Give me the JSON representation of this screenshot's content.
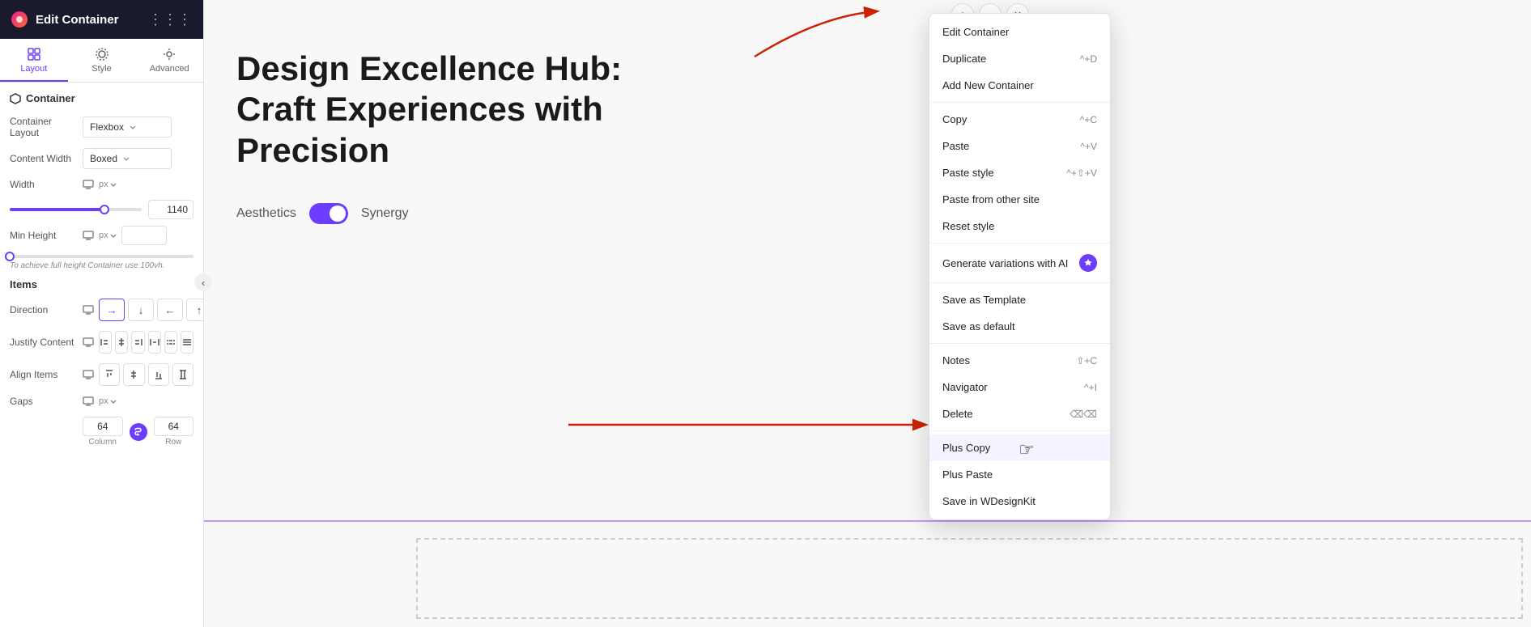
{
  "sidebar": {
    "title": "Edit Container",
    "tabs": [
      {
        "id": "layout",
        "label": "Layout",
        "active": true
      },
      {
        "id": "style",
        "label": "Style",
        "active": false
      },
      {
        "id": "advanced",
        "label": "Advanced",
        "active": false
      }
    ],
    "container_section": "Container",
    "fields": {
      "container_layout": {
        "label": "Container Layout",
        "value": "Flexbox"
      },
      "content_width": {
        "label": "Content Width",
        "value": "Boxed"
      },
      "width": {
        "label": "Width",
        "unit": "px",
        "slider_pct": 72,
        "value": "1140"
      },
      "min_height": {
        "label": "Min Height",
        "unit": "px",
        "value": ""
      }
    },
    "hint": "To achieve full height Container use 100vh.",
    "items_section": "Items",
    "direction": {
      "label": "Direction",
      "buttons": [
        "→",
        "↓",
        "←",
        "↑"
      ],
      "active_index": 0
    },
    "justify_content": {
      "label": "Justify Content",
      "buttons": 6
    },
    "align_items": {
      "label": "Align Items",
      "buttons": 4
    },
    "gaps": {
      "label": "Gaps",
      "unit": "px",
      "column": {
        "value": "64",
        "label": "Column"
      },
      "row": {
        "value": "64",
        "label": "Row"
      }
    }
  },
  "canvas": {
    "heading": "Design Excellence Hub: Craft Experiences with Precision",
    "label_left": "Aesthetics",
    "label_right": "Synergy"
  },
  "context_menu": {
    "items": [
      {
        "id": "edit-container",
        "label": "Edit Container",
        "shortcut": ""
      },
      {
        "id": "duplicate",
        "label": "Duplicate",
        "shortcut": "^+D"
      },
      {
        "id": "add-new-container",
        "label": "Add New Container",
        "shortcut": ""
      },
      {
        "id": "copy",
        "label": "Copy",
        "shortcut": "^+C"
      },
      {
        "id": "paste",
        "label": "Paste",
        "shortcut": "^+V"
      },
      {
        "id": "paste-style",
        "label": "Paste style",
        "shortcut": "^+⇧+V"
      },
      {
        "id": "paste-from-other",
        "label": "Paste from other site",
        "shortcut": ""
      },
      {
        "id": "reset-style",
        "label": "Reset style",
        "shortcut": ""
      },
      {
        "id": "generate-variations",
        "label": "Generate variations with AI",
        "shortcut": "",
        "badge": true
      },
      {
        "id": "save-as-template",
        "label": "Save as Template",
        "shortcut": ""
      },
      {
        "id": "save-as-default",
        "label": "Save as default",
        "shortcut": ""
      },
      {
        "id": "notes",
        "label": "Notes",
        "shortcut": "⇧+C"
      },
      {
        "id": "navigator",
        "label": "Navigator",
        "shortcut": "^+I"
      },
      {
        "id": "delete",
        "label": "Delete",
        "shortcut": "⌫⌫"
      },
      {
        "id": "plus-copy",
        "label": "Plus Copy",
        "shortcut": "",
        "hovered": true
      },
      {
        "id": "plus-paste",
        "label": "Plus Paste",
        "shortcut": ""
      },
      {
        "id": "save-in-wdesignkit",
        "label": "Save in WDesignKit",
        "shortcut": ""
      }
    ]
  }
}
